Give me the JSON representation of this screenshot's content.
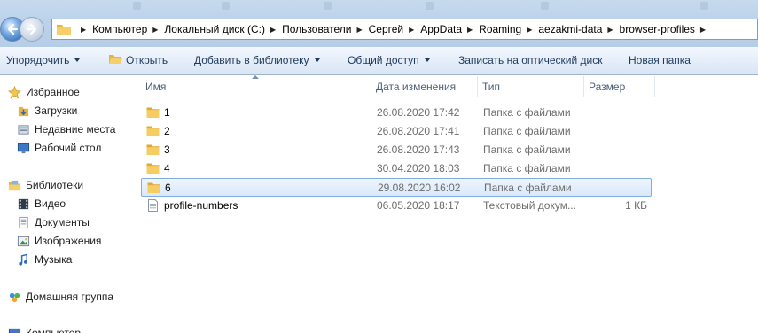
{
  "window": {
    "address_path": [
      "Компьютер",
      "Локальный диск (C:)",
      "Пользователи",
      "Сергей",
      "AppData",
      "Roaming",
      "aezakmi-data",
      "browser-profiles"
    ]
  },
  "toolbar": {
    "organize_label": "Упорядочить",
    "open_label": "Открыть",
    "add_to_library_label": "Добавить в библиотеку",
    "share_label": "Общий доступ",
    "burn_label": "Записать на оптический диск",
    "new_folder_label": "Новая папка"
  },
  "sidebar": {
    "favorites": {
      "label": "Избранное",
      "items": [
        {
          "label": "Загрузки",
          "icon": "downloads-icon"
        },
        {
          "label": "Недавние места",
          "icon": "recent-places-icon"
        },
        {
          "label": "Рабочий стол",
          "icon": "desktop-icon"
        }
      ]
    },
    "libraries": {
      "label": "Библиотеки",
      "items": [
        {
          "label": "Видео",
          "icon": "video-icon"
        },
        {
          "label": "Документы",
          "icon": "documents-icon"
        },
        {
          "label": "Изображения",
          "icon": "pictures-icon"
        },
        {
          "label": "Музыка",
          "icon": "music-icon"
        }
      ]
    },
    "homegroup": {
      "label": "Домашняя группа"
    },
    "computer": {
      "label": "Компьютер"
    }
  },
  "columns": {
    "name": "Имя",
    "date": "Дата изменения",
    "type": "Тип",
    "size": "Размер"
  },
  "files": [
    {
      "name": "1",
      "date": "26.08.2020 17:42",
      "type": "Папка с файлами",
      "size": "",
      "kind": "folder",
      "selected": false
    },
    {
      "name": "2",
      "date": "26.08.2020 17:41",
      "type": "Папка с файлами",
      "size": "",
      "kind": "folder",
      "selected": false
    },
    {
      "name": "3",
      "date": "26.08.2020 17:43",
      "type": "Папка с файлами",
      "size": "",
      "kind": "folder",
      "selected": false
    },
    {
      "name": "4",
      "date": "30.04.2020 18:03",
      "type": "Папка с файлами",
      "size": "",
      "kind": "folder",
      "selected": false
    },
    {
      "name": "6",
      "date": "29.08.2020 16:02",
      "type": "Папка с файлами",
      "size": "",
      "kind": "folder",
      "selected": true
    },
    {
      "name": "profile-numbers",
      "date": "06.05.2020 18:17",
      "type": "Текстовый докум...",
      "size": "1 КБ",
      "kind": "text",
      "selected": false
    }
  ],
  "colors": {
    "accent": "#1e395b",
    "selection_border": "#84acdd",
    "folder": "#f2c250"
  }
}
